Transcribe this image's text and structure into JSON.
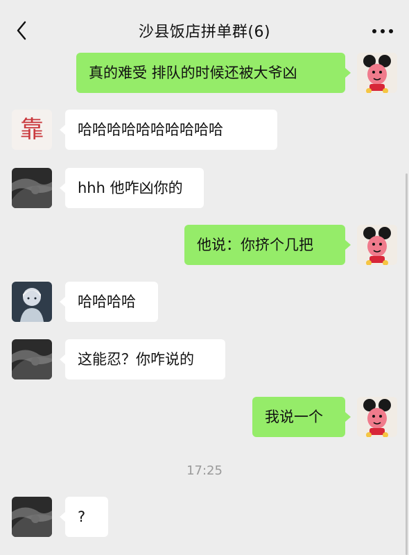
{
  "header": {
    "title": "沙县饭店拼单群(6)",
    "back_icon": "chevron-left-icon",
    "more_icon": "ellipsis-icon"
  },
  "messages": [
    {
      "side": "out",
      "text": "真的难受 排队的时候还被大爷凶"
    },
    {
      "side": "in",
      "text": "哈哈哈哈哈哈哈哈哈哈"
    },
    {
      "side": "in",
      "text": "hhh 他咋凶你的"
    },
    {
      "side": "out",
      "text": "他说：你挤个几把"
    },
    {
      "side": "in",
      "text": "哈哈哈哈"
    },
    {
      "side": "in",
      "text": "这能忍？你咋说的"
    },
    {
      "side": "out",
      "text": "我说一个"
    },
    {
      "side": "in",
      "text": "?"
    }
  ],
  "timestamp": "17:25",
  "avatar_text": "靠",
  "colors": {
    "background": "#ededed",
    "outgoing_bubble": "#95ec69",
    "incoming_bubble": "#ffffff"
  }
}
